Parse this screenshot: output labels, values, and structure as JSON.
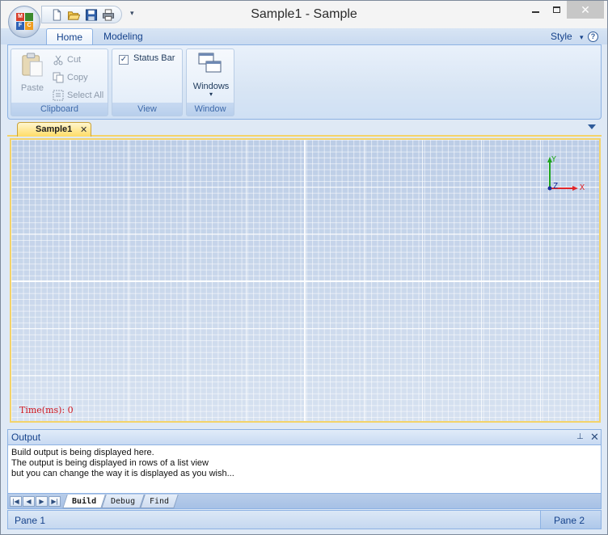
{
  "window": {
    "title": "Sample1 - Sample",
    "controls": {
      "minimize": "–",
      "maximize": "□",
      "close": "✕"
    }
  },
  "app_menu": {
    "icon": "office-orb-icon",
    "logo_letters": [
      "M",
      "F",
      "C",
      ""
    ]
  },
  "quick_access": {
    "items": [
      "new-document-icon",
      "open-folder-icon",
      "save-disk-icon",
      "print-icon"
    ],
    "customize_glyph": "▾"
  },
  "ribbon_tabs": [
    {
      "label": "Home",
      "active": true
    },
    {
      "label": "Modeling",
      "active": false
    }
  ],
  "style_menu": {
    "label": "Style",
    "arrow": "▾"
  },
  "help": {
    "glyph": "?"
  },
  "ribbon": {
    "clipboard": {
      "label": "Clipboard",
      "paste": "Paste",
      "cut": "Cut",
      "copy": "Copy",
      "select_all": "Select All"
    },
    "view": {
      "label": "View",
      "status_bar": "Status Bar",
      "status_bar_checked": true,
      "check_glyph": "✓"
    },
    "window": {
      "label": "Window",
      "windows": "Windows",
      "arrow": "▾"
    }
  },
  "document_tabs": {
    "tabs": [
      {
        "label": "Sample1",
        "close": "✕"
      }
    ]
  },
  "viewport": {
    "time_label": "Time(ms): 0",
    "axes": {
      "x": "X",
      "y": "Y",
      "z": "Z"
    },
    "colors": {
      "x": "#e0262a",
      "y": "#1fa51f",
      "z": "#1c2f9a",
      "grid": "#c5d4ea",
      "border": "#f3d36a"
    }
  },
  "output": {
    "title": "Output",
    "pin_glyph": "⊥",
    "close_glyph": "✕",
    "lines": [
      "Build output is being displayed here.",
      "The output is being displayed in rows of a list view",
      "but you can change the way it is displayed as you wish..."
    ],
    "nav": [
      "|◀",
      "◀",
      "▶",
      "▶|"
    ],
    "tabs": [
      {
        "label": "Build",
        "active": true
      },
      {
        "label": "Debug",
        "active": false
      },
      {
        "label": "Find",
        "active": false
      }
    ]
  },
  "statusbar": {
    "pane1": "Pane 1",
    "pane2": "Pane 2"
  }
}
